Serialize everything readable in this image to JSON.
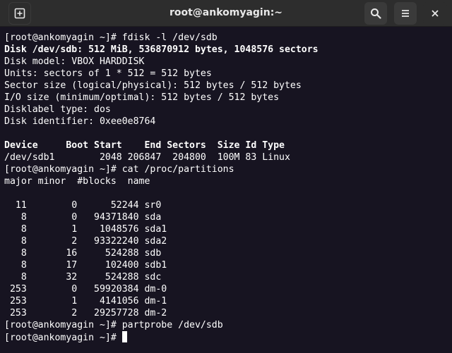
{
  "window": {
    "title": "root@ankomyagin:~",
    "icons": {
      "new_tab": "new-tab-icon",
      "search": "search-icon",
      "menu": "hamburger-menu-icon",
      "close": "close-icon"
    }
  },
  "terminal": {
    "lines": [
      "[root@ankomyagin ~]# fdisk -l /dev/sdb",
      "Disk /dev/sdb: 512 MiB, 536870912 bytes, 1048576 sectors",
      "Disk model: VBOX HARDDISK",
      "Units: sectors of 1 * 512 = 512 bytes",
      "Sector size (logical/physical): 512 bytes / 512 bytes",
      "I/O size (minimum/optimal): 512 bytes / 512 bytes",
      "Disklabel type: dos",
      "Disk identifier: 0xee0e8764",
      "",
      "Device     Boot Start    End Sectors  Size Id Type",
      "/dev/sdb1        2048 206847  204800  100M 83 Linux",
      "[root@ankomyagin ~]# cat /proc/partitions",
      "major minor  #blocks  name",
      "",
      "  11        0      52244 sr0",
      "   8        0   94371840 sda",
      "   8        1    1048576 sda1",
      "   8        2   93322240 sda2",
      "   8       16     524288 sdb",
      "   8       17     102400 sdb1",
      "   8       32     524288 sdc",
      " 253        0   59920384 dm-0",
      " 253        1    4141056 dm-1",
      " 253        2   29257728 dm-2",
      "[root@ankomyagin ~]# partprobe /dev/sdb",
      "[root@ankomyagin ~]# "
    ],
    "bold_lines": [
      1,
      9
    ]
  }
}
